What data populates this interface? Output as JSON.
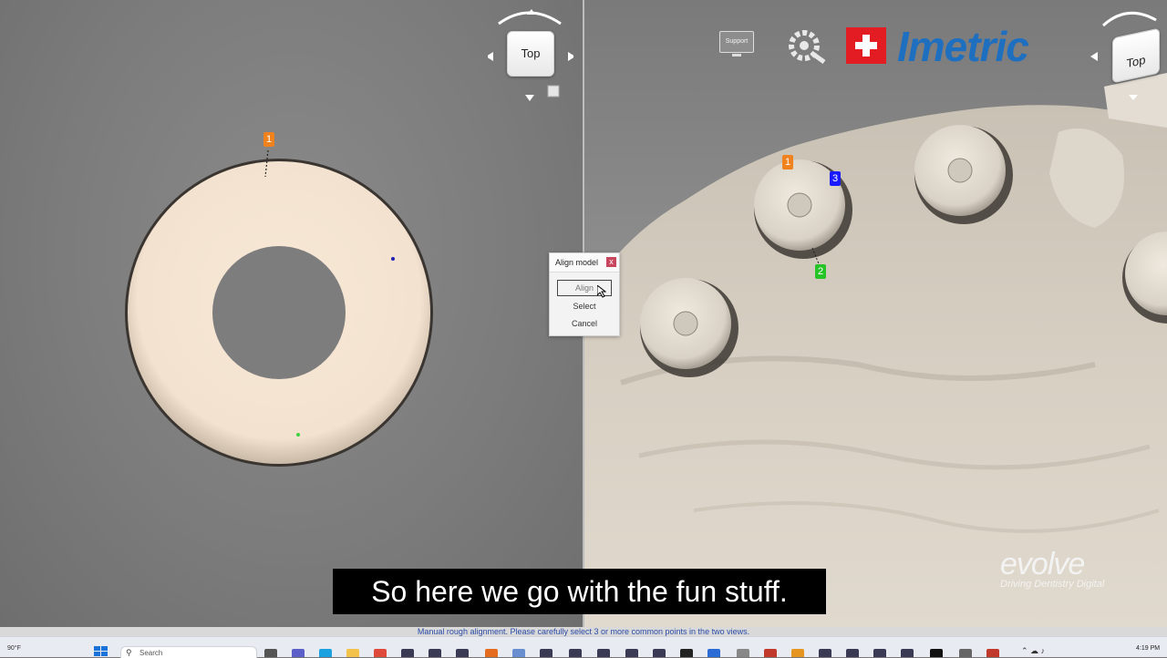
{
  "left_view": {
    "nav_cube_label": "Top",
    "markers": [
      {
        "label": "1",
        "color": "#f0821e"
      }
    ]
  },
  "right_view": {
    "nav_cube_label": "Top",
    "support_label": "Support",
    "brand_name": "Imetric",
    "markers": [
      {
        "label": "1",
        "color": "#f0821e"
      },
      {
        "label": "3",
        "color": "#1a1aff"
      },
      {
        "label": "2",
        "color": "#27c427"
      }
    ]
  },
  "dialog": {
    "title": "Align model",
    "close_glyph": "x",
    "buttons": [
      "Align",
      "Select",
      "Cancel"
    ]
  },
  "subtitle": "So here we go with the fun stuff.",
  "watermark": {
    "name": "evolve",
    "tagline": "Driving Dentistry Digital"
  },
  "status_message": "Manual rough alignment. Please carefully select 3 or more common points in the two views.",
  "taskbar": {
    "weather": "90°F",
    "search_label": "Search",
    "time": "4:19 PM"
  },
  "colors": {
    "accent_blue": "#1f6fc0",
    "close_red": "#c8475f",
    "brand_red": "#e31b23"
  }
}
